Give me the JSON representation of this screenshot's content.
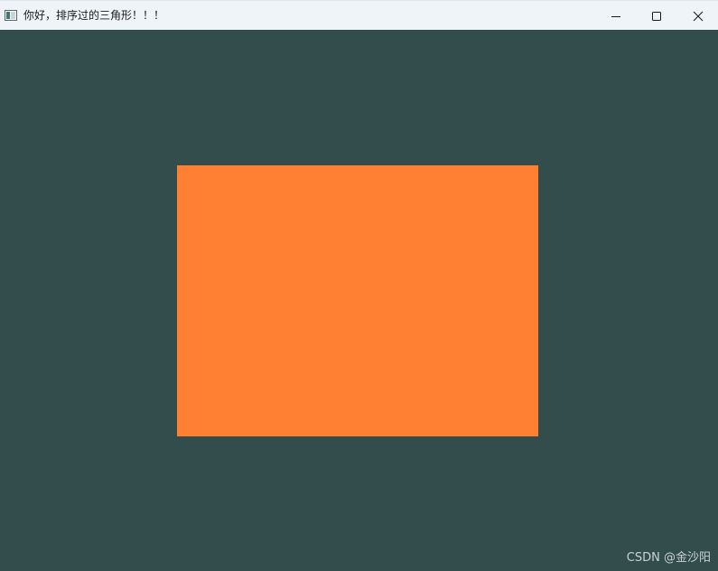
{
  "window": {
    "title": "你好，排序过的三角形！！！"
  },
  "icons": {
    "app": "app-window-icon",
    "minimize": "minimize-icon",
    "maximize": "maximize-icon",
    "close": "close-icon"
  },
  "colors": {
    "titlebar": "#eff4f9",
    "clear_color": "#334d4d",
    "shape_fill": "#ff8033"
  },
  "watermark": {
    "text": "CSDN @金沙阳"
  }
}
